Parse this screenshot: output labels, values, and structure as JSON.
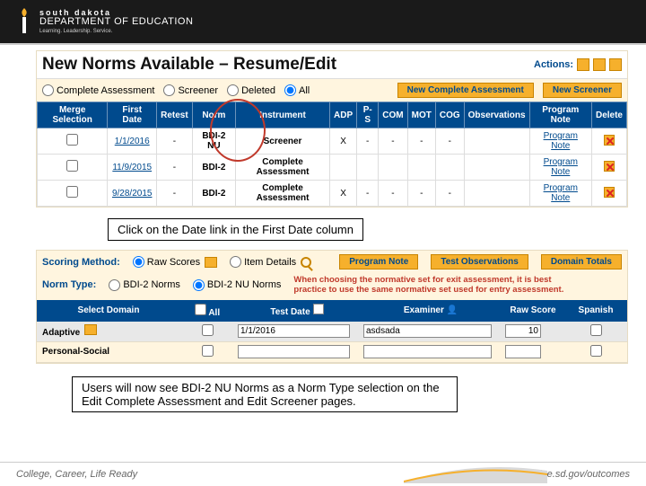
{
  "header": {
    "state": "south dakota",
    "dept": "DEPARTMENT OF EDUCATION",
    "tagline": "Learning. Leadership. Service."
  },
  "panel1": {
    "title": "New Norms Available – Resume/Edit",
    "actions_label": "Actions:",
    "filters": {
      "complete": "Complete Assessment",
      "screener": "Screener",
      "deleted": "Deleted",
      "all": "All",
      "new_complete": "New Complete Assessment",
      "new_screener": "New Screener"
    },
    "columns": {
      "merge": "Merge Selection",
      "first_date": "First Date",
      "retest": "Retest",
      "norm": "Norm",
      "instrument": "Instrument",
      "adp": "ADP",
      "ps": "P-S",
      "com": "COM",
      "mot": "MOT",
      "cog": "COG",
      "obs": "Observations",
      "pnote": "Program Note",
      "delete": "Delete"
    },
    "rows": [
      {
        "date": "1/1/2016",
        "retest": "-",
        "norm": "BDI-2 NU",
        "inst": "Screener",
        "adp": "X",
        "ps": "-",
        "com": "-",
        "mot": "-",
        "cog": "-",
        "obs": "",
        "pnote": "Program Note"
      },
      {
        "date": "11/9/2015",
        "retest": "-",
        "norm": "BDI-2",
        "inst": "Complete Assessment",
        "adp": "",
        "ps": "",
        "com": "",
        "mot": "",
        "cog": "",
        "obs": "",
        "pnote": "Program Note"
      },
      {
        "date": "9/28/2015",
        "retest": "-",
        "norm": "BDI-2",
        "inst": "Complete Assessment",
        "adp": "X",
        "ps": "-",
        "com": "-",
        "mot": "-",
        "cog": "-",
        "obs": "",
        "pnote": "Program Note"
      }
    ]
  },
  "hint1": "Click on the Date link in the First Date column",
  "panel2": {
    "scoring_label": "Scoring Method:",
    "raw": "Raw Scores",
    "item": "Item Details",
    "btn_pnote": "Program Note",
    "btn_tobs": "Test Observations",
    "btn_dtot": "Domain Totals",
    "norm_label": "Norm Type:",
    "bdi2": "BDI-2 Norms",
    "bdi2nu": "BDI-2 NU Norms",
    "red_note": "When choosing the normative set for exit assessment, it is best practice to use the same normative set used for entry assessment.",
    "columns": {
      "domain": "Select Domain",
      "all": "All",
      "tdate": "Test Date",
      "exam": "Examiner",
      "raw": "Raw Score",
      "span": "Spanish"
    },
    "rows": [
      {
        "domain": "Adaptive",
        "date": "1/1/2016",
        "exam": "asdsada",
        "raw": "10"
      },
      {
        "domain": "Personal-Social",
        "date": "",
        "exam": "",
        "raw": ""
      }
    ]
  },
  "hint2": "Users will now see BDI-2 NU Norms as a Norm Type selection on the Edit Complete Assessment and Edit Screener pages.",
  "footer": {
    "left": "College, Career, Life Ready",
    "right": "doe.sd.gov/outcomes"
  }
}
